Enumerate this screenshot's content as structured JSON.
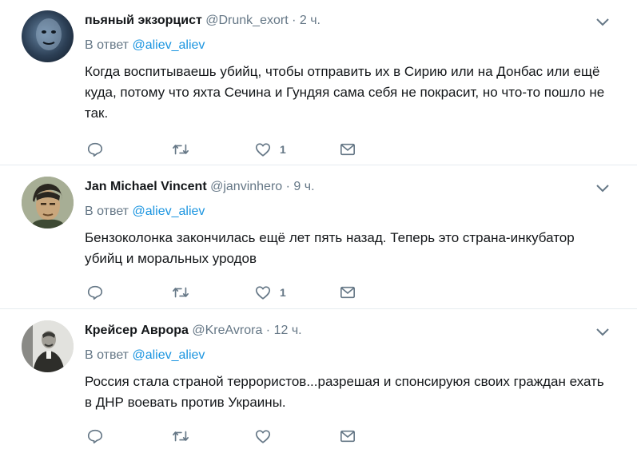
{
  "reply_prefix": "В ответ",
  "tweets": [
    {
      "name": "пьяный экзорцист",
      "handle": "@Drunk_exort",
      "dot": "·",
      "time": "2 ч.",
      "reply_to": "@aliev_aliev",
      "text": "Когда воспитываешь убийц, чтобы отправить их в Сирию или на Донбас или ещё куда, потому что яхта Сечина и Гундяя сама себя не покрасит, но что-то пошло не так.",
      "likes": "1"
    },
    {
      "name": "Jan Michael Vincent",
      "handle": "@janvinhero",
      "dot": "·",
      "time": "9 ч.",
      "reply_to": "@aliev_aliev",
      "text": "Бензоколонка закончилась ещё лет пять назад. Теперь это страна-инкубатор убийц и моральных уродов",
      "likes": "1"
    },
    {
      "name": "Крейсер Аврора",
      "handle": "@KreAvrora",
      "dot": "·",
      "time": "12 ч.",
      "reply_to": "@aliev_aliev",
      "text": "Россия стала страной террористов...разрешая и спонсируюя своих граждан ехать в ДНР воевать против Украины.",
      "likes": ""
    }
  ],
  "colors": {
    "link": "#1b95e0",
    "muted": "#657786",
    "text": "#14171a",
    "divider": "#e6ecf0"
  },
  "icons": [
    "reply-icon",
    "retweet-icon",
    "like-icon",
    "message-icon",
    "chevron-down-icon"
  ]
}
